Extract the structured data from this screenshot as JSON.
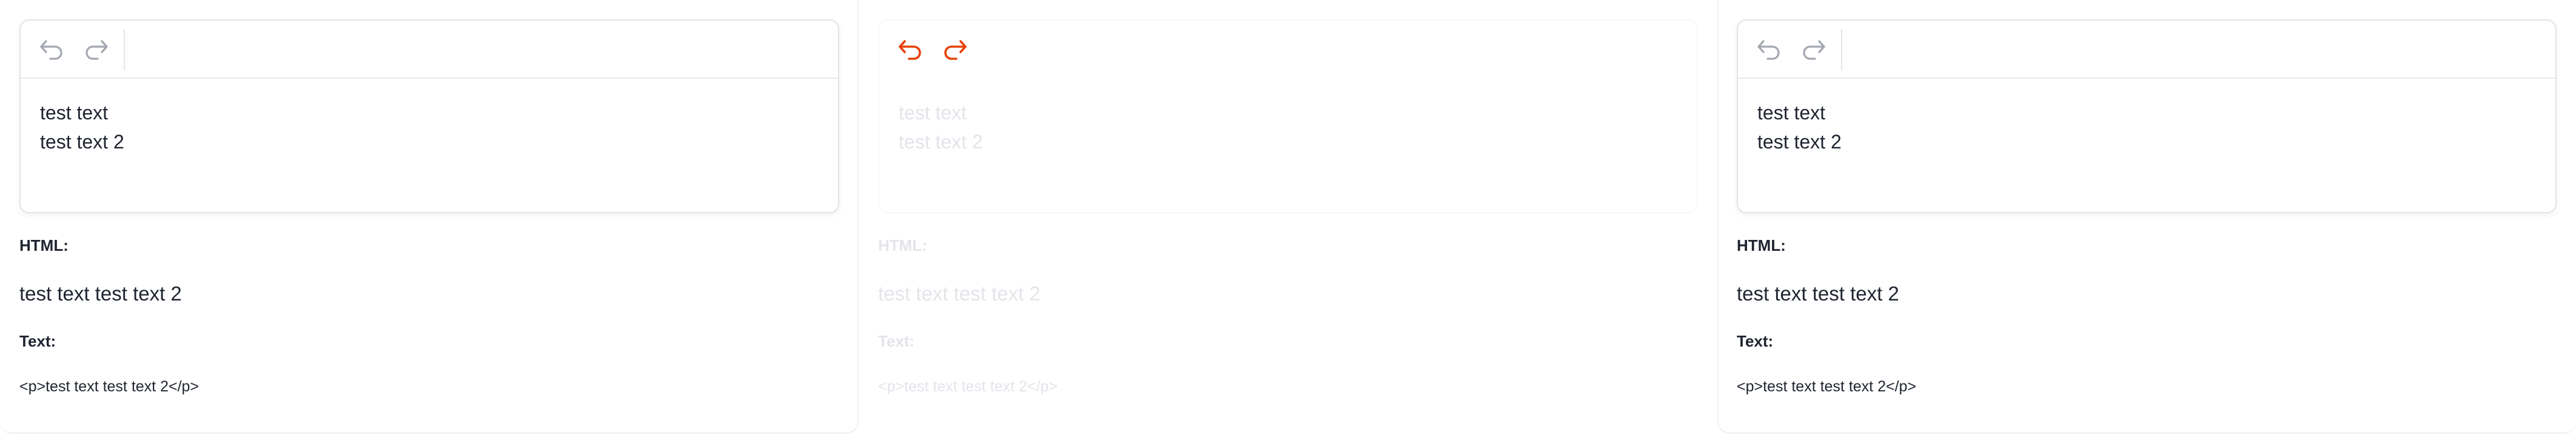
{
  "colors": {
    "text": "#1f2430",
    "icon_disabled": "#a3a7b0",
    "icon_active": "#e8410c",
    "faded_text": "#e3e5ea",
    "border": "#e2e4e9"
  },
  "panels": [
    {
      "state": "normal",
      "toolbar": {
        "undo_icon": "undo-icon",
        "redo_icon": "redo-icon",
        "undo_enabled": false,
        "redo_enabled": false
      },
      "content": {
        "line_1": "test text",
        "line_2": "test text 2"
      },
      "html_label": "HTML:",
      "html_output": "test text test text 2",
      "text_label": "Text:",
      "text_output": "<p>test text test text 2</p>"
    },
    {
      "state": "faded",
      "toolbar": {
        "undo_icon": "undo-icon",
        "redo_icon": "redo-icon",
        "undo_enabled": true,
        "redo_enabled": true
      },
      "content": {
        "line_1": "test text",
        "line_2": "test text 2"
      },
      "html_label": "HTML:",
      "html_output": "test text test text 2",
      "text_label": "Text:",
      "text_output": "<p>test text test text 2</p>"
    },
    {
      "state": "normal",
      "toolbar": {
        "undo_icon": "undo-icon",
        "redo_icon": "redo-icon",
        "undo_enabled": false,
        "redo_enabled": false
      },
      "content": {
        "line_1": "test text",
        "line_2": "test text 2"
      },
      "html_label": "HTML:",
      "html_output": "test text test text 2",
      "text_label": "Text:",
      "text_output": "<p>test text test text 2</p>"
    }
  ]
}
